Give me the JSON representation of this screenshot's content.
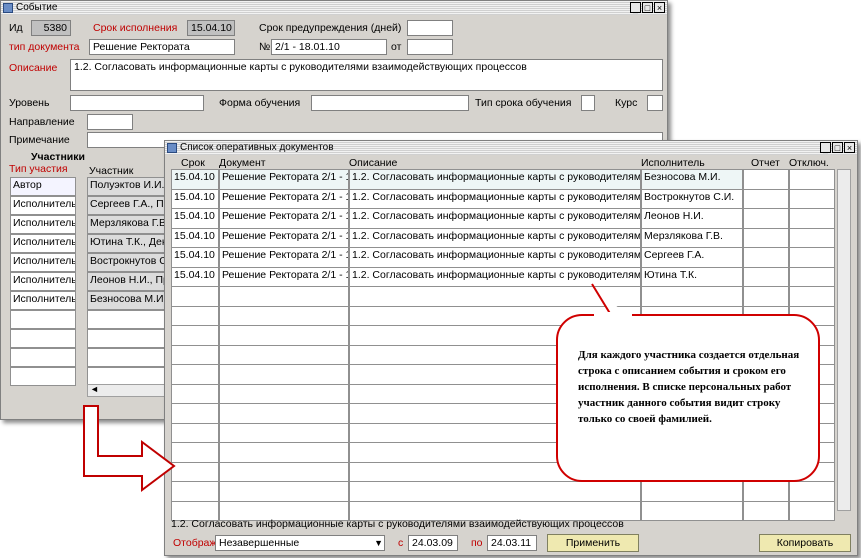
{
  "event_window": {
    "title": "Событие",
    "id_label": "Ид",
    "id_value": "5380",
    "deadline_label": "Срок исполнения",
    "deadline_value": "15.04.10",
    "warning_label": "Срок предупреждения (дней)",
    "warning_value": "",
    "doctype_label": "тип документа",
    "doctype_value": "Решение Ректората",
    "number_label": "№",
    "number_value": "2/1 - 18.01.10",
    "from_label": "от",
    "from_value": "",
    "description_label": "Описание",
    "description_value": "1.2. Согласовать информационные карты с руководителями взаимодействующих процессов",
    "level_label": "Уровень",
    "study_form_label": "Форма обучения",
    "study_term_label": "Тип срока обучения",
    "course_label": "Курс",
    "direction_label": "Направление",
    "note_label": "Примечание",
    "participants_heading": "Участники",
    "participation_type_header": "Тип участия",
    "participant_header": "Участник",
    "participants": [
      {
        "type": "Автор",
        "name": "Полуэктов И.И., ..."
      },
      {
        "type": "Исполнитель",
        "name": "Сергеев Г.А., П..."
      },
      {
        "type": "Исполнитель",
        "name": "Мерзлякова Г.В..."
      },
      {
        "type": "Исполнитель",
        "name": "Ютина Т.К., Дек..."
      },
      {
        "type": "Исполнитель",
        "name": "Вострокнутов С..."
      },
      {
        "type": "Исполнитель",
        "name": "Леонов Н.И., Пр..."
      },
      {
        "type": "Исполнитель",
        "name": "Безносова М.И., ..."
      }
    ]
  },
  "docs_window": {
    "title": "Список оперативных документов",
    "columns": [
      "Срок",
      "Документ",
      "Описание",
      "Исполнитель",
      "Отчет",
      "Отключ."
    ],
    "rows": [
      {
        "term": "15.04.10",
        "doc": "Решение Ректората 2/1 - 1",
        "desc": "1.2. Согласовать информационные карты с руководителями",
        "executor": "Безносова М.И."
      },
      {
        "term": "15.04.10",
        "doc": "Решение Ректората 2/1 - 1",
        "desc": "1.2. Согласовать информационные карты с руководителями",
        "executor": "Вострокнутов С.И."
      },
      {
        "term": "15.04.10",
        "doc": "Решение Ректората 2/1 - 1",
        "desc": "1.2. Согласовать информационные карты с руководителями",
        "executor": "Леонов Н.И."
      },
      {
        "term": "15.04.10",
        "doc": "Решение Ректората 2/1 - 1",
        "desc": "1.2. Согласовать информационные карты с руководителями",
        "executor": "Мерзлякова Г.В."
      },
      {
        "term": "15.04.10",
        "doc": "Решение Ректората 2/1 - 1",
        "desc": "1.2. Согласовать информационные карты с руководителями",
        "executor": "Сергеев Г.А."
      },
      {
        "term": "15.04.10",
        "doc": "Решение Ректората 2/1 - 1",
        "desc": "1.2. Согласовать информационные карты с руководителями",
        "executor": "Ютина Т.К."
      }
    ],
    "status_text": "1.2. Согласовать информационные карты с руководителями взаимодействующих процессов",
    "filter_label": "Отображать",
    "filter_value": "Незавершенные",
    "from_label": "с",
    "from_date": "24.03.09",
    "to_label": "по",
    "to_date": "24.03.11",
    "apply_button": "Применить",
    "copy_button": "Копировать"
  },
  "callout": {
    "text": "Для каждого участника создается отдельная строка с описанием события и сроком его исполнения. В списке персональных работ участник данного события видит строку только со своей фамилией."
  },
  "colors": {
    "window_bg": "#d6d3ce",
    "label_red": "#c00000",
    "button_bg": "#efe9b0",
    "callout_border": "#d00000"
  }
}
